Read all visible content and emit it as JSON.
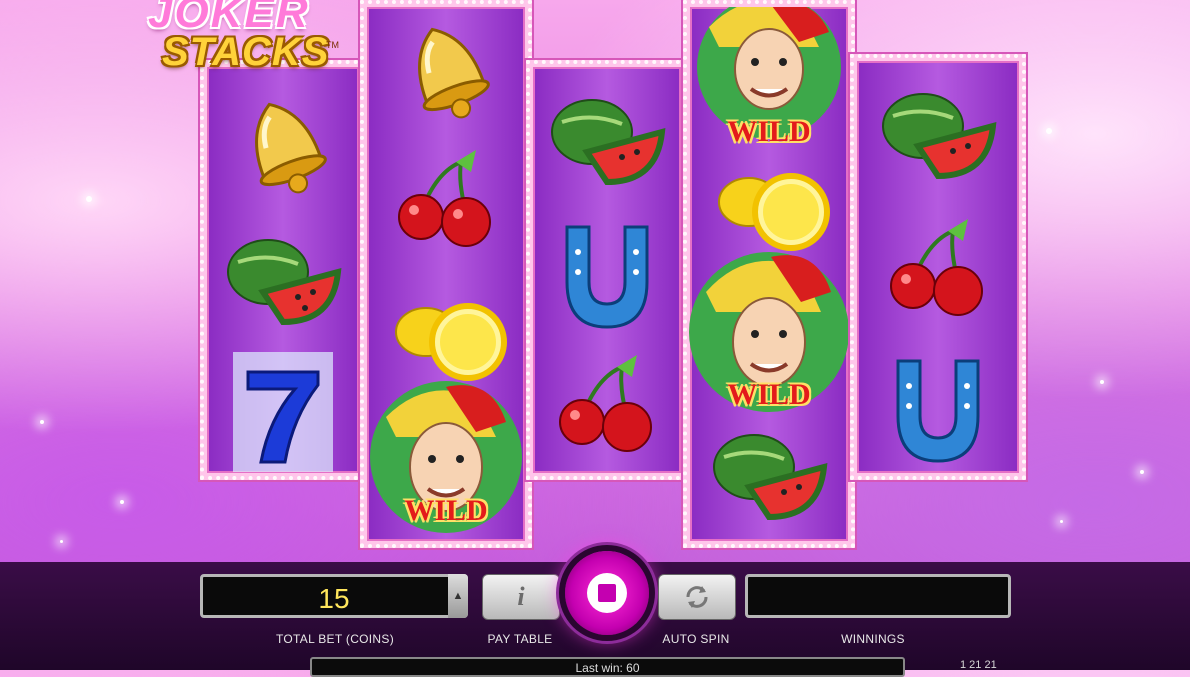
{
  "game": {
    "logo_line1": "JOKER",
    "logo_line2": "STACKS",
    "logo_tm": "TM"
  },
  "reels": [
    [
      "bell-icon",
      "watermelon-icon",
      "seven-icon"
    ],
    [
      "bell-icon",
      "cherries-icon",
      "lemon-icon",
      "joker-wild-icon"
    ],
    [
      "watermelon-icon",
      "horseshoe-icon",
      "cherries-icon"
    ],
    [
      "joker-wild-icon",
      "lemon-icon",
      "joker-wild-icon",
      "watermelon-icon"
    ],
    [
      "watermelon-icon",
      "cherries-icon",
      "horseshoe-icon"
    ]
  ],
  "wild_label": "WILD",
  "controls": {
    "total_bet_value": "15",
    "total_bet_label": "TOTAL BET (COINS)",
    "pay_table_label": "PAY TABLE",
    "pay_table_icon": "i",
    "auto_spin_label": "AUTO SPIN",
    "winnings_label": "WINNINGS",
    "winnings_value": "",
    "last_win_text": "Last win: 60",
    "corner_text": "1 21 21"
  },
  "colors": {
    "spin_button": "#c400b0",
    "reel_bg": "#9b3fd0",
    "bet_text": "#ffe65c"
  }
}
